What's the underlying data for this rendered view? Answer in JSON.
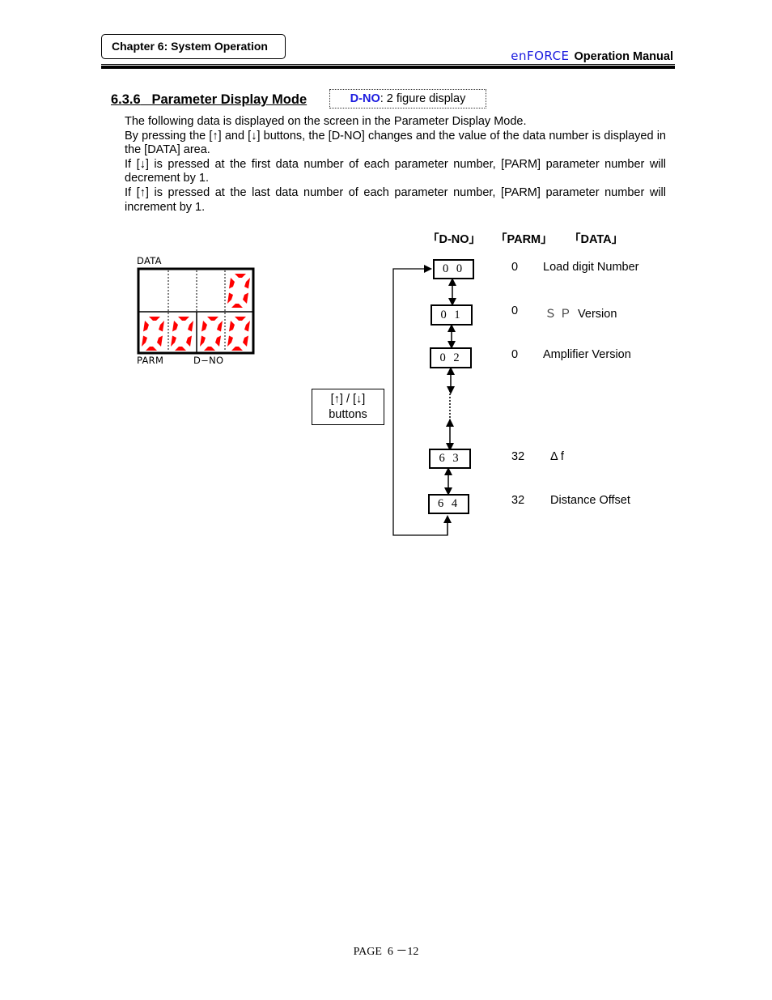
{
  "header": {
    "chapter": "Chapter 6: System Operation",
    "brand_logo": "enFORCE",
    "brand_suffix": "Operation  Manual",
    "brand_color": "#1a1adf"
  },
  "section": {
    "number": "6.3.6",
    "title": "Parameter Display Mode",
    "note_key": "D-NO",
    "note_text": ": 2 figure display"
  },
  "body": {
    "paragraphs": [
      "The following data is displayed on the screen in the Parameter Display Mode.",
      "By pressing the [↑] and [↓] buttons, the [D-NO] changes and the value of the data number is displayed in the [DATA] area.",
      "If [↓] is pressed at the first data number of each parameter number, [PARM] parameter number will decrement by 1.",
      "If [↑] is pressed at the last data number of each parameter number, [PARM] parameter number will increment by 1."
    ]
  },
  "display_panel": {
    "data_label": "DATA",
    "parm_label": "PARM",
    "dno_label": "D−NO",
    "data_value": "0",
    "parm_value": "00",
    "dno_value": "00",
    "segment_color": "#ff0000"
  },
  "table_headers": {
    "dno": "「D-NO」",
    "parm": "「PARM」",
    "data": "「DATA」"
  },
  "buttons_box": {
    "line1": "[↑] / [↓]",
    "line2": "buttons"
  },
  "rows": [
    {
      "dno": "0 0",
      "parm": "0",
      "data_prefix": "",
      "data": "Load digit Number"
    },
    {
      "dno": "0 1",
      "parm": "0",
      "data_prefix": "ＳＰ",
      "data": "Version"
    },
    {
      "dno": "0 2",
      "parm": "0",
      "data_prefix": "",
      "data": "Amplifier Version"
    },
    {
      "dno": "6 3",
      "parm": "32",
      "data_prefix": "",
      "data": "Δ f"
    },
    {
      "dno": "6 4",
      "parm": "32",
      "data_prefix": "",
      "data": "Distance Offset"
    }
  ],
  "footer": {
    "page": "PAGE  6 －12"
  }
}
